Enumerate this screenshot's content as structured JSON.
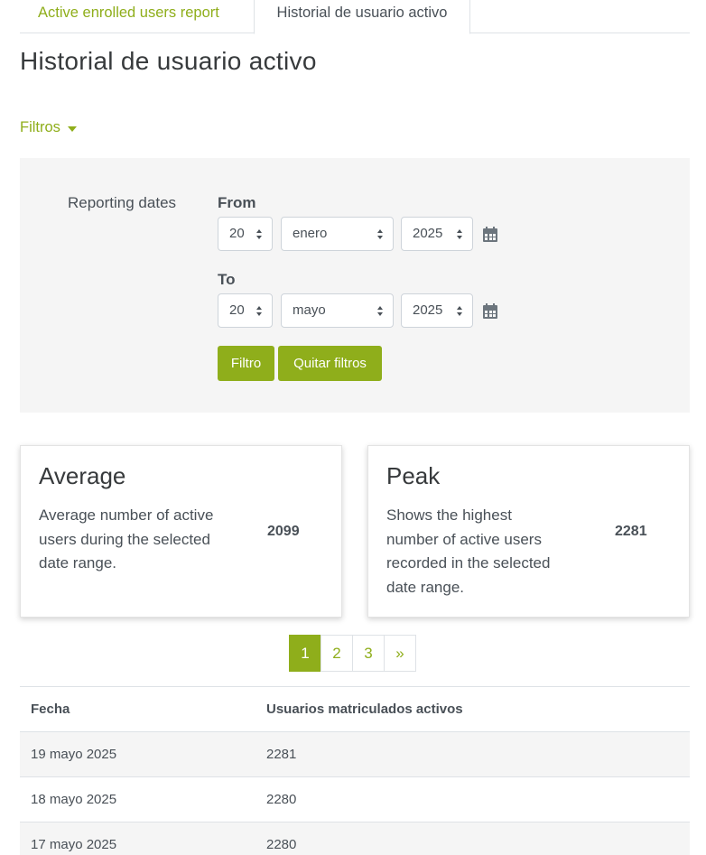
{
  "tabs": [
    {
      "label": "Active enrolled users report"
    },
    {
      "label": "Historial de usuario activo"
    }
  ],
  "page_title": "Historial de usuario activo",
  "filters": {
    "toggle_label": "Filtros",
    "reporting_label": "Reporting dates",
    "from_label": "From",
    "to_label": "To",
    "from": {
      "day": "20",
      "month": "enero",
      "year": "2025"
    },
    "to": {
      "day": "20",
      "month": "mayo",
      "year": "2025"
    },
    "filter_button": "Filtro",
    "clear_button": "Quitar filtros"
  },
  "cards": {
    "average": {
      "title": "Average",
      "description": "Average number of active users during the selected date range.",
      "value": "2099"
    },
    "peak": {
      "title": "Peak",
      "description": "Shows the highest number of active users recorded in the selected date range.",
      "value": "2281"
    }
  },
  "pagination": {
    "pages": [
      "1",
      "2",
      "3"
    ],
    "active": "1",
    "next": "»"
  },
  "table": {
    "headers": [
      "Fecha",
      "Usuarios matriculados activos"
    ],
    "rows": [
      [
        "19 mayo 2025",
        "2281"
      ],
      [
        "18 mayo 2025",
        "2280"
      ],
      [
        "17 mayo 2025",
        "2280"
      ]
    ]
  },
  "colors": {
    "accent": "#8fae1b",
    "panel_bg": "#f5f5f5"
  },
  "icons": {
    "calendar": "calendar-icon",
    "caret": "caret-down-icon"
  }
}
